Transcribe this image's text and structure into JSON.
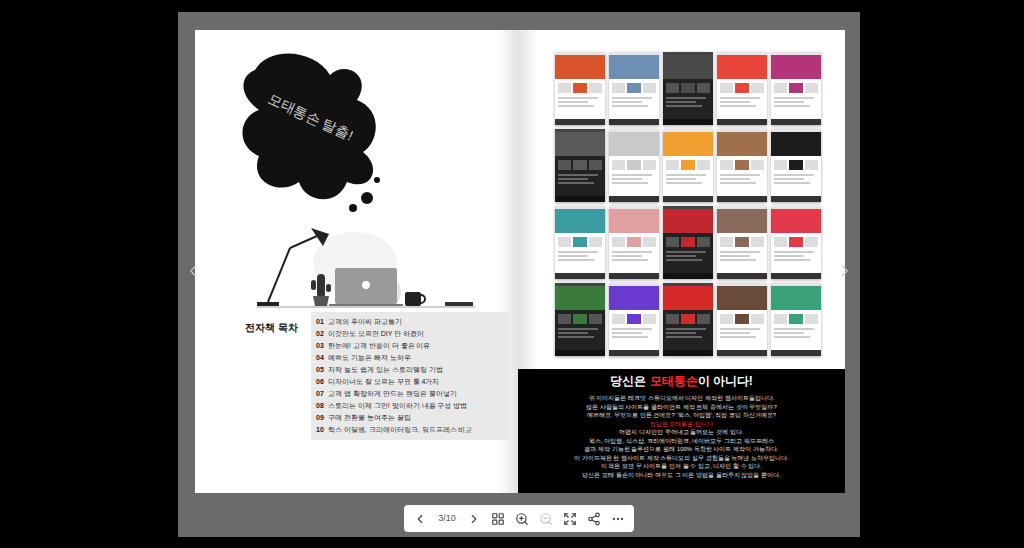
{
  "left_page": {
    "illustration_text": "모태통손 탈출!",
    "toc": {
      "title": "전자책 목차",
      "items": [
        {
          "number": "01",
          "label": "고객의 후이씨 파고들기"
        },
        {
          "number": "02",
          "label": "이것만도 모르면 DIY 안 하겠어"
        },
        {
          "number": "03",
          "label": "한눈에! 고객 반응이 더 좋은 이유"
        },
        {
          "number": "04",
          "label": "예쁘도 기능은 빠져 노하우"
        },
        {
          "number": "05",
          "label": "저작 늦도 쉽게 있는 스토리텔링 기법"
        },
        {
          "number": "06",
          "label": "디자이너도 잘 모르는 꾸묘 툴 4가지"
        },
        {
          "number": "07",
          "label": "고객 앱 확장하게 만드는 랜딩은 불어넣기"
        },
        {
          "number": "08",
          "label": "스토리는 이제 그만! 맞이하기 내용 구성 방법"
        },
        {
          "number": "09",
          "label": "구매 전환을 높여주는 꿀팁"
        },
        {
          "number": "10",
          "label": "윅스 어딜엠, 크리에이터링크, 워드프레스 비교"
        }
      ]
    }
  },
  "right_page": {
    "thumbnails": [
      {
        "kind": "light",
        "color": "#d9542b"
      },
      {
        "kind": "light",
        "color": "#6d8fb5"
      },
      {
        "kind": "dark",
        "color": "#4a4a4a"
      },
      {
        "kind": "light",
        "color": "#e8443a"
      },
      {
        "kind": "light",
        "color": "#b4347a"
      },
      {
        "kind": "dark",
        "color": "#5a5a5a"
      },
      {
        "kind": "light",
        "color": "#c9c9c9"
      },
      {
        "kind": "light",
        "color": "#f0a030"
      },
      {
        "kind": "light",
        "color": "#a0704a"
      },
      {
        "kind": "light",
        "color": "#1c1c1c"
      },
      {
        "kind": "light",
        "color": "#3a9ca0"
      },
      {
        "kind": "light",
        "color": "#e0a0a0"
      },
      {
        "kind": "dark",
        "color": "#c0282d"
      },
      {
        "kind": "light",
        "color": "#8a6a5a"
      },
      {
        "kind": "light",
        "color": "#e23a4a"
      },
      {
        "kind": "dark",
        "color": "#3a7a3a"
      },
      {
        "kind": "light",
        "color": "#6a3ad0"
      },
      {
        "kind": "dark",
        "color": "#d42a2a"
      },
      {
        "kind": "light",
        "color": "#6a4a3a"
      },
      {
        "kind": "light",
        "color": "#3aa07a"
      }
    ],
    "banner": {
      "heading": {
        "before": "당신은 ",
        "highlight": "모태통손",
        "after": "이 아니다!"
      },
      "lines": [
        {
          "text": "위 이미지들은 테크빗 스튜디오에서 디자인 제작한 웹사이트들입니다.",
          "highlight": false
        },
        {
          "text": "많은 사람들의 사이트를 클라이언트 제작 전체 중에서는 것이 무엇일까?",
          "highlight": false
        },
        {
          "text": "예쁘해요. 무엇으로 만든 건데요? '윅스, 아임웹', 직접 코딩 하신거예요?",
          "highlight": false
        },
        {
          "text": "정답은 모태통손 입니다",
          "highlight": true
        },
        {
          "text": "어렵지 디자인만 주어내고 들어보는 것에 있다.",
          "highlight": false
        },
        {
          "text": "윅스, 아임웹, 식스샵, 크리에이터링크, 네이버모두 그리고 워드프레스",
          "highlight": false
        },
        {
          "text": "결과 제작 기능한 솔루션으로 원래 100% 독창한 사이트 제작이 가능하다.",
          "highlight": false
        },
        {
          "text": "이 가이드북은 한 웹사이트 제작 스튜디오의 실무 경험들을 녹여낸 노하우입니다.",
          "highlight": false
        },
        {
          "text": "이 책은 보면 무 사이트를 만져 볼 수 있고, 디자인 할 수 있다.",
          "highlight": false
        },
        {
          "text": "당신은 모태 통손이 아니라 여우도 그 이은 방법을 몰라주지 않았을 뿐이다.",
          "highlight": false
        }
      ]
    }
  },
  "toolbar": {
    "items": [
      {
        "kind": "prev",
        "disabled": false
      },
      {
        "kind": "page",
        "text": "3/10",
        "disabled": false
      },
      {
        "kind": "next",
        "disabled": false
      },
      {
        "kind": "grid",
        "disabled": false
      },
      {
        "kind": "zoom-in",
        "disabled": false
      },
      {
        "kind": "zoom-out",
        "disabled": true
      },
      {
        "kind": "fullscreen",
        "disabled": false
      },
      {
        "kind": "share",
        "disabled": false
      },
      {
        "kind": "more",
        "disabled": false
      }
    ]
  }
}
